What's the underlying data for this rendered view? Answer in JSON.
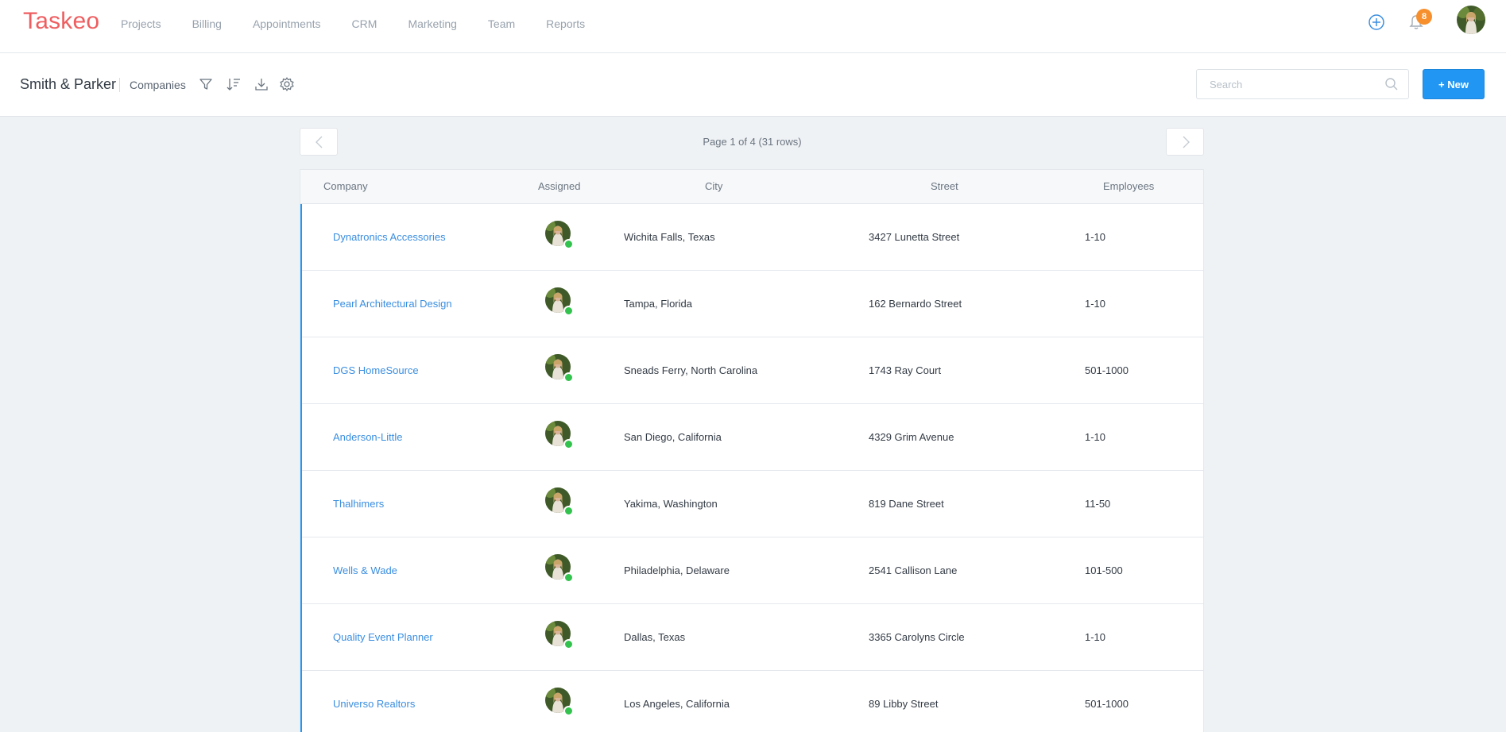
{
  "app": {
    "logo": "Taskeo",
    "nav": [
      "Projects",
      "Billing",
      "Appointments",
      "CRM",
      "Marketing",
      "Team",
      "Reports"
    ],
    "notifications_count": "8",
    "icons": [
      "plus-circle-icon",
      "bell-icon",
      "user-avatar"
    ]
  },
  "subheader": {
    "org_name": "Smith & Parker",
    "section": "Companies",
    "tools": [
      "filter-icon",
      "sort-icon",
      "download-icon",
      "settings-icon"
    ],
    "search_placeholder": "Search",
    "new_button": "+ New"
  },
  "pagination": {
    "label": "Page 1 of 4 (31 rows)"
  },
  "table": {
    "columns": [
      "Company",
      "Assigned",
      "City",
      "Street",
      "Employees"
    ],
    "rows": [
      {
        "company": "Dynatronics Accessories",
        "city": "Wichita Falls, Texas",
        "street": "3427 Lunetta Street",
        "employees": "1-10"
      },
      {
        "company": "Pearl Architectural Design",
        "city": "Tampa, Florida",
        "street": "162 Bernardo Street",
        "employees": "1-10"
      },
      {
        "company": "DGS HomeSource",
        "city": "Sneads Ferry, North Carolina",
        "street": "1743 Ray Court",
        "employees": "501-1000"
      },
      {
        "company": "Anderson-Little",
        "city": "San Diego, California",
        "street": "4329 Grim Avenue",
        "employees": "1-10"
      },
      {
        "company": "Thalhimers",
        "city": "Yakima, Washington",
        "street": "819 Dane Street",
        "employees": "11-50"
      },
      {
        "company": "Wells & Wade",
        "city": "Philadelphia, Delaware",
        "street": "2541 Callison Lane",
        "employees": "101-500"
      },
      {
        "company": "Quality Event Planner",
        "city": "Dallas, Texas",
        "street": "3365 Carolyns Circle",
        "employees": "1-10"
      },
      {
        "company": "Universo Realtors",
        "city": "Los Angeles, California",
        "street": "89 Libby Street",
        "employees": "501-1000"
      }
    ]
  },
  "colors": {
    "brand": "#ee5e60",
    "accent": "#2196f3",
    "link": "#3a8ee0",
    "badge": "#f7902c",
    "online": "#33c24d"
  }
}
